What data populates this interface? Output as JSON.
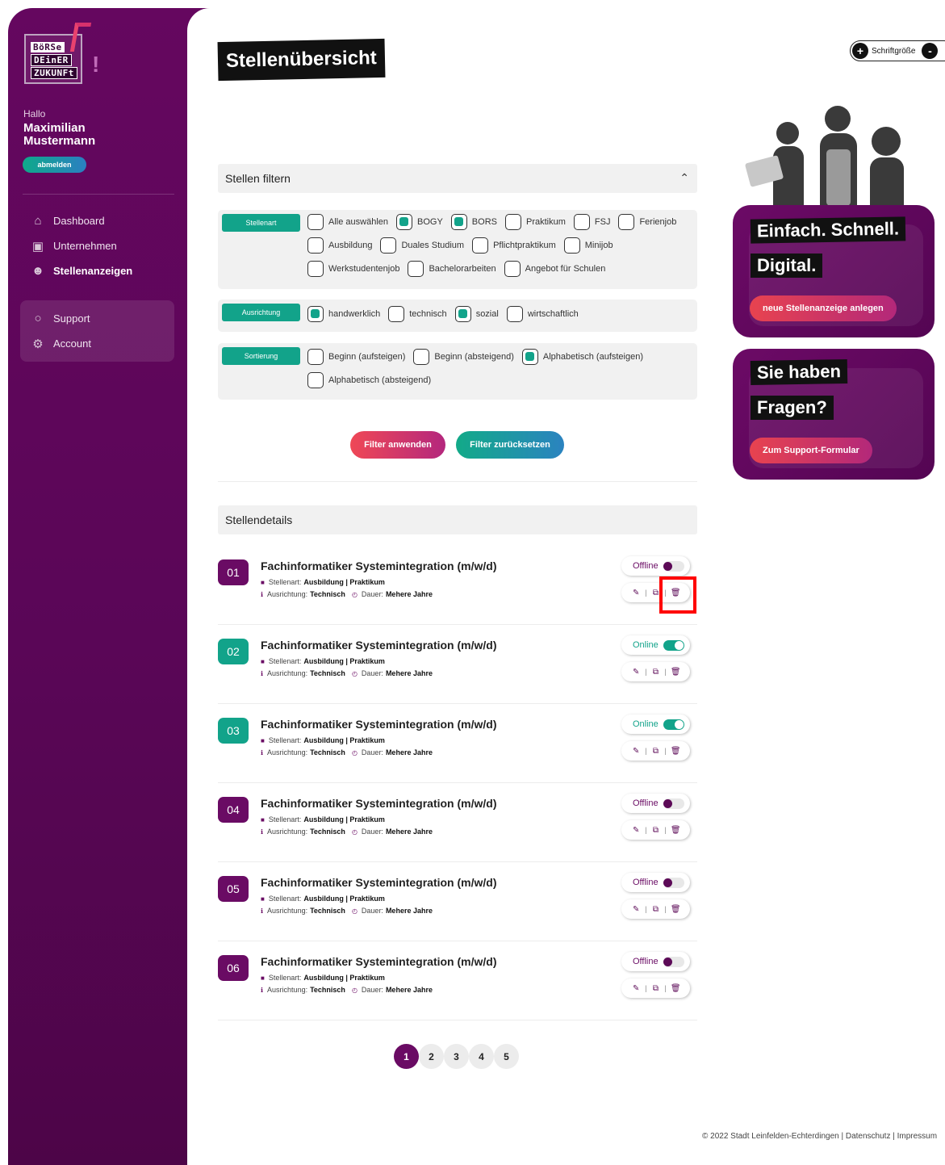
{
  "sidebar": {
    "logo_words": [
      "BöRSe",
      "DEinER",
      "ZUKUNFt"
    ],
    "hello": "Hallo",
    "user_name": "Maximilian Mustermann",
    "logout_label": "abmelden",
    "nav": [
      {
        "label": "Dashboard",
        "icon": "home-icon",
        "active": false
      },
      {
        "label": "Unternehmen",
        "icon": "briefcase-icon",
        "active": false
      },
      {
        "label": "Stellenanzeigen",
        "icon": "users-icon",
        "active": true
      }
    ],
    "nav2": [
      {
        "label": "Support",
        "icon": "chat-bubble-icon"
      },
      {
        "label": "Account",
        "icon": "gears-icon"
      }
    ]
  },
  "header": {
    "title": "Stellenübersicht",
    "fontsize_label": "Schriftgröße",
    "plus": "+",
    "minus": "-"
  },
  "filter": {
    "heading": "Stellen filtern",
    "groups": [
      {
        "tag": "Stellenart",
        "options": [
          {
            "label": "Alle auswählen",
            "checked": false
          },
          {
            "label": "BOGY",
            "checked": true
          },
          {
            "label": "BORS",
            "checked": true
          },
          {
            "label": "Praktikum",
            "checked": false
          },
          {
            "label": "FSJ",
            "checked": false
          },
          {
            "label": "Ferienjob",
            "checked": false
          },
          {
            "label": "Ausbildung",
            "checked": false
          },
          {
            "label": "Duales Studium",
            "checked": false
          },
          {
            "label": "Pflichtpraktikum",
            "checked": false
          },
          {
            "label": "Minijob",
            "checked": false
          },
          {
            "label": "Werkstudentenjob",
            "checked": false
          },
          {
            "label": "Bachelorarbeiten",
            "checked": false
          },
          {
            "label": "Angebot für Schulen",
            "checked": false
          }
        ]
      },
      {
        "tag": "Ausrichtung",
        "options": [
          {
            "label": "handwerklich",
            "checked": true
          },
          {
            "label": "technisch",
            "checked": false
          },
          {
            "label": "sozial",
            "checked": true
          },
          {
            "label": "wirtschaftlich",
            "checked": false
          }
        ]
      },
      {
        "tag": "Sortierung",
        "options": [
          {
            "label": "Beginn (aufsteigen)",
            "checked": false
          },
          {
            "label": "Beginn (absteigend)",
            "checked": false
          },
          {
            "label": "Alphabetisch (aufsteigen)",
            "checked": true
          },
          {
            "label": "Alphabetisch (absteigend)",
            "checked": false
          }
        ]
      }
    ],
    "apply_label": "Filter anwenden",
    "reset_label": "Filter zurücksetzen"
  },
  "details": {
    "heading": "Stellendetails",
    "jobs": [
      {
        "num": "01",
        "title": "Fachinformatiker Systemintegration (m/w/d)",
        "type_label": "Stellenart:",
        "type": "Ausbildung | Praktikum",
        "dir_label": "Ausrichtung:",
        "dir": "Technisch",
        "dur_label": "Dauer:",
        "dur": "Mehere Jahre",
        "status": "Offline",
        "online": false
      },
      {
        "num": "02",
        "title": "Fachinformatiker Systemintegration (m/w/d)",
        "type_label": "Stellenart:",
        "type": "Ausbildung | Praktikum",
        "dir_label": "Ausrichtung:",
        "dir": "Technisch",
        "dur_label": "Dauer:",
        "dur": "Mehere Jahre",
        "status": "Online",
        "online": true
      },
      {
        "num": "03",
        "title": "Fachinformatiker Systemintegration (m/w/d)",
        "type_label": "Stellenart:",
        "type": "Ausbildung | Praktikum",
        "dir_label": "Ausrichtung:",
        "dir": "Technisch",
        "dur_label": "Dauer:",
        "dur": "Mehere Jahre",
        "status": "Online",
        "online": true
      },
      {
        "num": "04",
        "title": "Fachinformatiker Systemintegration (m/w/d)",
        "type_label": "Stellenart:",
        "type": "Ausbildung | Praktikum",
        "dir_label": "Ausrichtung:",
        "dir": "Technisch",
        "dur_label": "Dauer:",
        "dur": "Mehere Jahre",
        "status": "Offline",
        "online": false
      },
      {
        "num": "05",
        "title": "Fachinformatiker Systemintegration (m/w/d)",
        "type_label": "Stellenart:",
        "type": "Ausbildung | Praktikum",
        "dir_label": "Ausrichtung:",
        "dir": "Technisch",
        "dur_label": "Dauer:",
        "dur": "Mehere Jahre",
        "status": "Offline",
        "online": false
      },
      {
        "num": "06",
        "title": "Fachinformatiker Systemintegration (m/w/d)",
        "type_label": "Stellenart:",
        "type": "Ausbildung | Praktikum",
        "dir_label": "Ausrichtung:",
        "dir": "Technisch",
        "dur_label": "Dauer:",
        "dur": "Mehere Jahre",
        "status": "Offline",
        "online": false
      }
    ],
    "separator": "|"
  },
  "pagination": [
    "1",
    "2",
    "3",
    "4",
    "5"
  ],
  "footer": "© 2022 Stadt Leinfelden-Echterdingen | Datenschutz | Impressum",
  "promo": {
    "line1": "Einfach. Schnell.",
    "line2": "Digital.",
    "button": "neue Stellenanzeige anlegen"
  },
  "support": {
    "line1": "Sie haben",
    "line2": "Fragen?",
    "button": "Zum Support-Formular"
  },
  "colors": {
    "brand_purple": "#65075f",
    "teal": "#12a38a",
    "red_accent": "#ef4856",
    "highlight": "#ff0000"
  }
}
